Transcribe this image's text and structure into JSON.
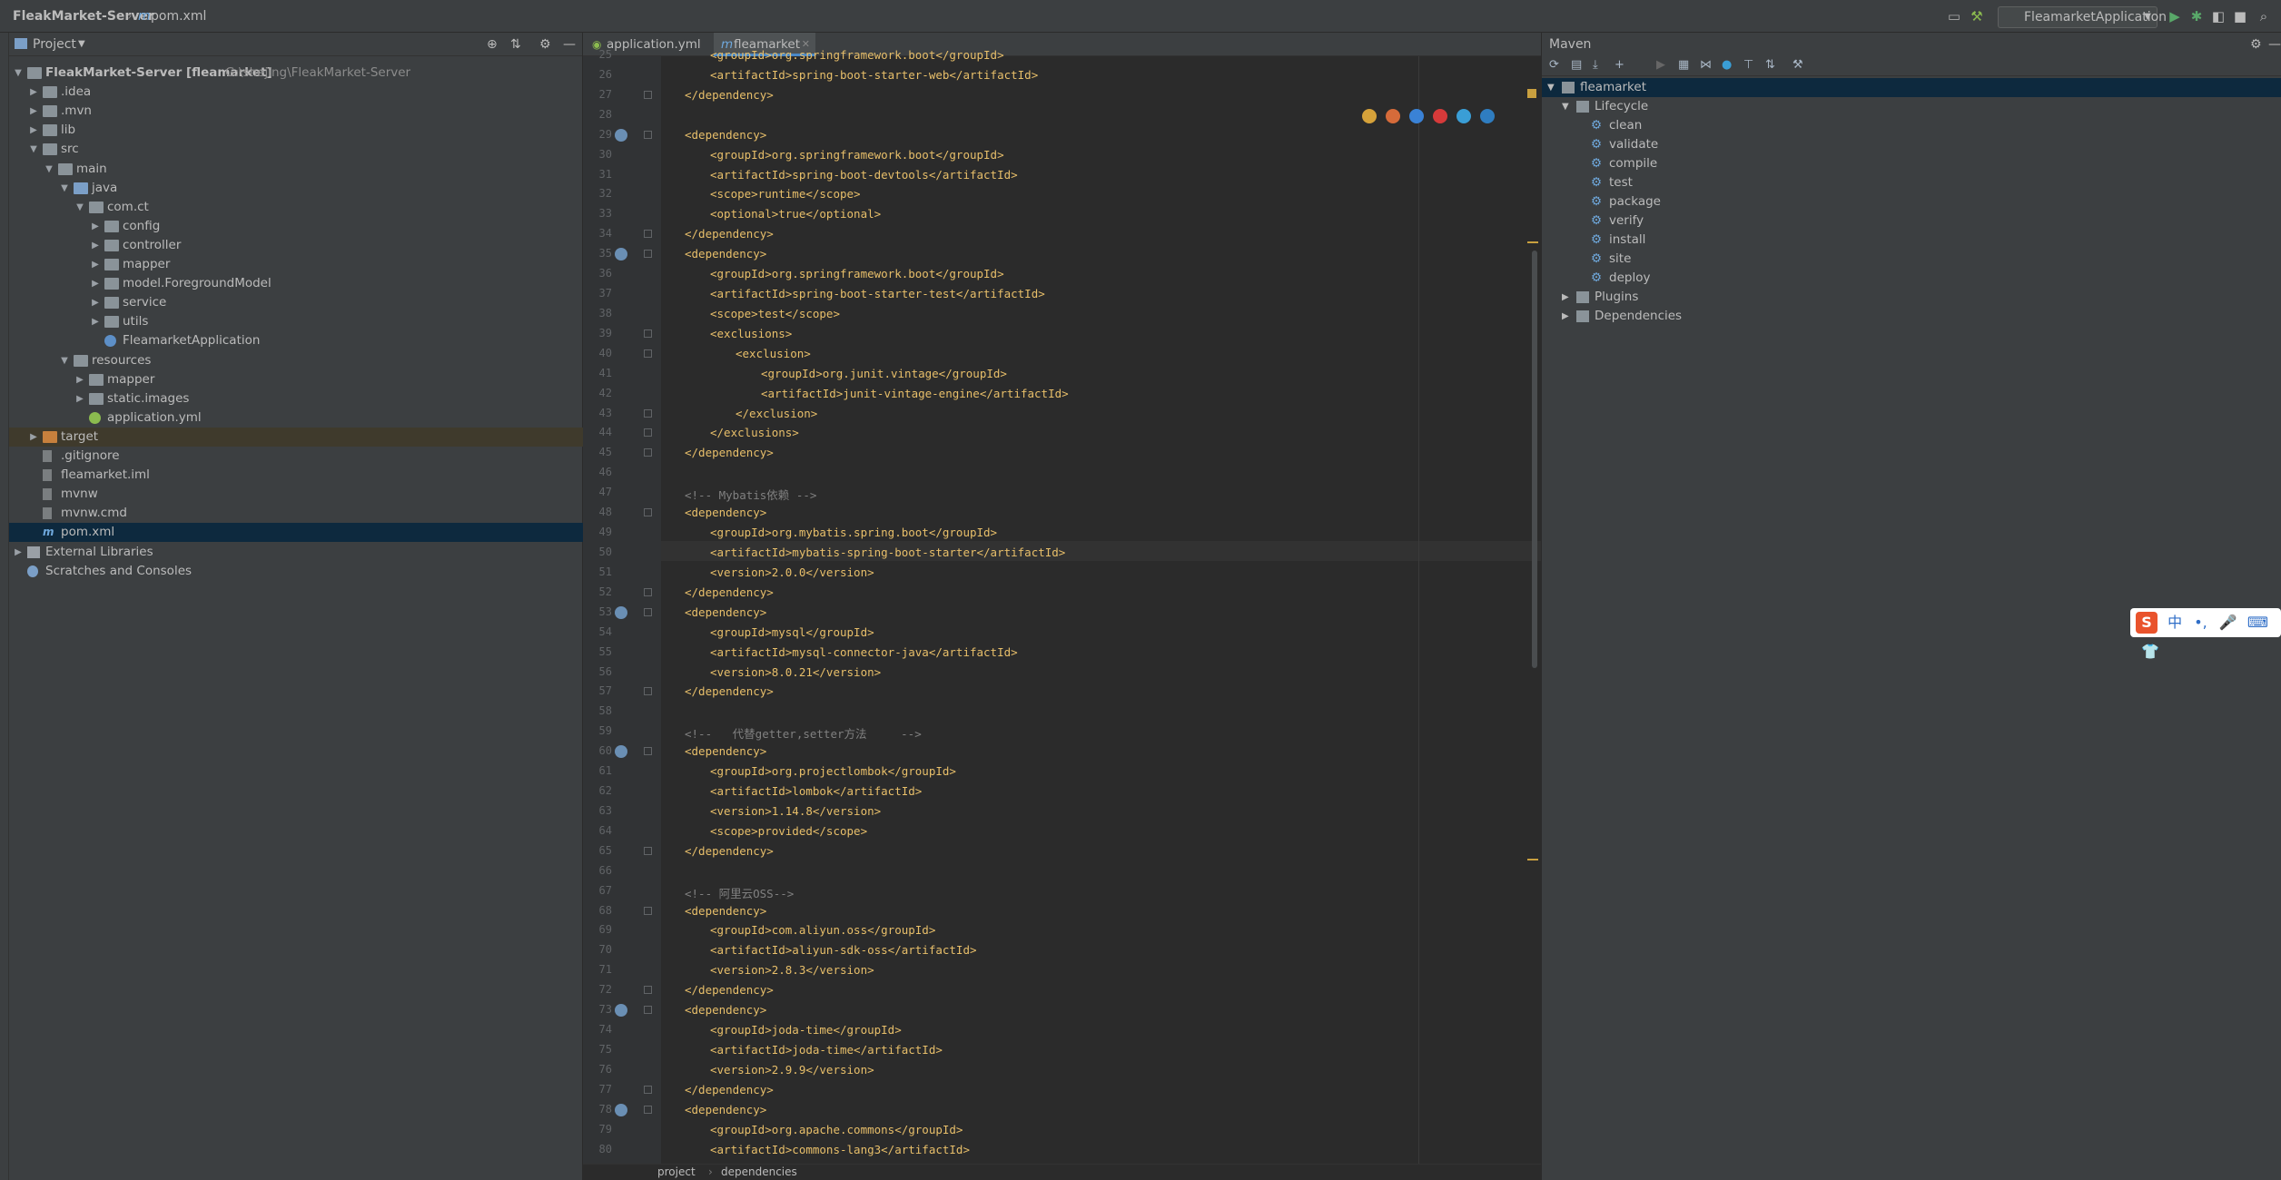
{
  "navbar": {
    "project_name": "FleakMarket-Server",
    "file_name": "pom.xml",
    "file_icon": "m",
    "run_config": "FleamarketApplication"
  },
  "project_panel": {
    "title": "Project",
    "root_label": "FleakMarket-Server [fleamarket]",
    "root_path": "G:\\shejing\\FleakMarket-Server",
    "items": [
      {
        "label": ".idea",
        "depth": 1,
        "type": "folder",
        "expanded": false
      },
      {
        "label": ".mvn",
        "depth": 1,
        "type": "folder",
        "expanded": false
      },
      {
        "label": "lib",
        "depth": 1,
        "type": "folder",
        "expanded": false
      },
      {
        "label": "src",
        "depth": 1,
        "type": "folder",
        "expanded": true
      },
      {
        "label": "main",
        "depth": 2,
        "type": "folder",
        "expanded": true
      },
      {
        "label": "java",
        "depth": 3,
        "type": "folder-blue",
        "expanded": true
      },
      {
        "label": "com.ct",
        "depth": 4,
        "type": "folder",
        "expanded": true
      },
      {
        "label": "config",
        "depth": 5,
        "type": "folder",
        "expanded": false
      },
      {
        "label": "controller",
        "depth": 5,
        "type": "folder",
        "expanded": false
      },
      {
        "label": "mapper",
        "depth": 5,
        "type": "folder",
        "expanded": false
      },
      {
        "label": "model.ForegroundModel",
        "depth": 5,
        "type": "folder",
        "expanded": false
      },
      {
        "label": "service",
        "depth": 5,
        "type": "folder",
        "expanded": false
      },
      {
        "label": "utils",
        "depth": 5,
        "type": "folder",
        "expanded": false
      },
      {
        "label": "FleamarketApplication",
        "depth": 5,
        "type": "class",
        "expanded": null
      },
      {
        "label": "resources",
        "depth": 3,
        "type": "folder",
        "expanded": true
      },
      {
        "label": "mapper",
        "depth": 4,
        "type": "folder",
        "expanded": false
      },
      {
        "label": "static.images",
        "depth": 4,
        "type": "folder",
        "expanded": false
      },
      {
        "label": "application.yml",
        "depth": 4,
        "type": "yml",
        "expanded": null
      },
      {
        "label": "target",
        "depth": 1,
        "type": "folder-orange",
        "expanded": false
      },
      {
        "label": ".gitignore",
        "depth": 1,
        "type": "file",
        "expanded": null
      },
      {
        "label": "fleamarket.iml",
        "depth": 1,
        "type": "file",
        "expanded": null
      },
      {
        "label": "mvnw",
        "depth": 1,
        "type": "file",
        "expanded": null
      },
      {
        "label": "mvnw.cmd",
        "depth": 1,
        "type": "file",
        "expanded": null
      },
      {
        "label": "pom.xml",
        "depth": 1,
        "type": "maven",
        "expanded": null
      }
    ],
    "external_libraries": "External Libraries",
    "scratches": "Scratches and Consoles"
  },
  "editor": {
    "tabs": [
      {
        "label": "application.yml",
        "active": false
      },
      {
        "label": "fleamarket",
        "active": true
      }
    ],
    "breadcrumb": [
      "project",
      "dependencies"
    ],
    "first_line_number": 25,
    "current_line": 50,
    "lines": [
      {
        "n": 25,
        "indent": 2,
        "text": "<groupId>org.springframework.boot</groupId>"
      },
      {
        "n": 26,
        "indent": 2,
        "text": "<artifactId>spring-boot-starter-web</artifactId>"
      },
      {
        "n": 27,
        "indent": 1,
        "text": "</dependency>"
      },
      {
        "n": 28,
        "indent": 0,
        "text": ""
      },
      {
        "n": 29,
        "indent": 1,
        "text": "<dependency>"
      },
      {
        "n": 30,
        "indent": 2,
        "text": "<groupId>org.springframework.boot</groupId>"
      },
      {
        "n": 31,
        "indent": 2,
        "text": "<artifactId>spring-boot-devtools</artifactId>"
      },
      {
        "n": 32,
        "indent": 2,
        "text": "<scope>runtime</scope>"
      },
      {
        "n": 33,
        "indent": 2,
        "text": "<optional>true</optional>"
      },
      {
        "n": 34,
        "indent": 1,
        "text": "</dependency>"
      },
      {
        "n": 35,
        "indent": 1,
        "text": "<dependency>"
      },
      {
        "n": 36,
        "indent": 2,
        "text": "<groupId>org.springframework.boot</groupId>"
      },
      {
        "n": 37,
        "indent": 2,
        "text": "<artifactId>spring-boot-starter-test</artifactId>"
      },
      {
        "n": 38,
        "indent": 2,
        "text": "<scope>test</scope>"
      },
      {
        "n": 39,
        "indent": 2,
        "text": "<exclusions>"
      },
      {
        "n": 40,
        "indent": 3,
        "text": "<exclusion>"
      },
      {
        "n": 41,
        "indent": 4,
        "text": "<groupId>org.junit.vintage</groupId>"
      },
      {
        "n": 42,
        "indent": 4,
        "text": "<artifactId>junit-vintage-engine</artifactId>"
      },
      {
        "n": 43,
        "indent": 3,
        "text": "</exclusion>"
      },
      {
        "n": 44,
        "indent": 2,
        "text": "</exclusions>"
      },
      {
        "n": 45,
        "indent": 1,
        "text": "</dependency>"
      },
      {
        "n": 46,
        "indent": 0,
        "text": ""
      },
      {
        "n": 47,
        "indent": 1,
        "text": "<!-- Mybatis依赖 -->"
      },
      {
        "n": 48,
        "indent": 1,
        "text": "<dependency>"
      },
      {
        "n": 49,
        "indent": 2,
        "text": "<groupId>org.mybatis.spring.boot</groupId>"
      },
      {
        "n": 50,
        "indent": 2,
        "text": "<artifactId>mybatis-spring-boot-starter</artifactId>"
      },
      {
        "n": 51,
        "indent": 2,
        "text": "<version>2.0.0</version>"
      },
      {
        "n": 52,
        "indent": 1,
        "text": "</dependency>"
      },
      {
        "n": 53,
        "indent": 1,
        "text": "<dependency>"
      },
      {
        "n": 54,
        "indent": 2,
        "text": "<groupId>mysql</groupId>"
      },
      {
        "n": 55,
        "indent": 2,
        "text": "<artifactId>mysql-connector-java</artifactId>"
      },
      {
        "n": 56,
        "indent": 2,
        "text": "<version>8.0.21</version>"
      },
      {
        "n": 57,
        "indent": 1,
        "text": "</dependency>"
      },
      {
        "n": 58,
        "indent": 0,
        "text": ""
      },
      {
        "n": 59,
        "indent": 1,
        "text": "<!--   代替getter,setter方法     -->"
      },
      {
        "n": 60,
        "indent": 1,
        "text": "<dependency>"
      },
      {
        "n": 61,
        "indent": 2,
        "text": "<groupId>org.projectlombok</groupId>"
      },
      {
        "n": 62,
        "indent": 2,
        "text": "<artifactId>lombok</artifactId>"
      },
      {
        "n": 63,
        "indent": 2,
        "text": "<version>1.14.8</version>"
      },
      {
        "n": 64,
        "indent": 2,
        "text": "<scope>provided</scope>"
      },
      {
        "n": 65,
        "indent": 1,
        "text": "</dependency>"
      },
      {
        "n": 66,
        "indent": 0,
        "text": ""
      },
      {
        "n": 67,
        "indent": 1,
        "text": "<!-- 阿里云OSS-->"
      },
      {
        "n": 68,
        "indent": 1,
        "text": "<dependency>"
      },
      {
        "n": 69,
        "indent": 2,
        "text": "<groupId>com.aliyun.oss</groupId>"
      },
      {
        "n": 70,
        "indent": 2,
        "text": "<artifactId>aliyun-sdk-oss</artifactId>"
      },
      {
        "n": 71,
        "indent": 2,
        "text": "<version>2.8.3</version>"
      },
      {
        "n": 72,
        "indent": 1,
        "text": "</dependency>"
      },
      {
        "n": 73,
        "indent": 1,
        "text": "<dependency>"
      },
      {
        "n": 74,
        "indent": 2,
        "text": "<groupId>joda-time</groupId>"
      },
      {
        "n": 75,
        "indent": 2,
        "text": "<artifactId>joda-time</artifactId>"
      },
      {
        "n": 76,
        "indent": 2,
        "text": "<version>2.9.9</version>"
      },
      {
        "n": 77,
        "indent": 1,
        "text": "</dependency>"
      },
      {
        "n": 78,
        "indent": 1,
        "text": "<dependency>"
      },
      {
        "n": 79,
        "indent": 2,
        "text": "<groupId>org.apache.commons</groupId>"
      },
      {
        "n": 80,
        "indent": 2,
        "text": "<artifactId>commons-lang3</artifactId>"
      }
    ]
  },
  "maven_panel": {
    "title": "Maven",
    "project": "fleamarket",
    "lifecycle_label": "Lifecycle",
    "lifecycle": [
      "clean",
      "validate",
      "compile",
      "test",
      "package",
      "verify",
      "install",
      "site",
      "deploy"
    ],
    "plugins_label": "Plugins",
    "dependencies_label": "Dependencies"
  },
  "ime": {
    "brand": "S",
    "mode": "中"
  },
  "colors": {
    "panel_bg": "#3c3f41",
    "editor_bg": "#2b2b2b",
    "xml_tag": "#e8bf6a",
    "selection": "#0d293e",
    "accent": "#4a88c7"
  }
}
